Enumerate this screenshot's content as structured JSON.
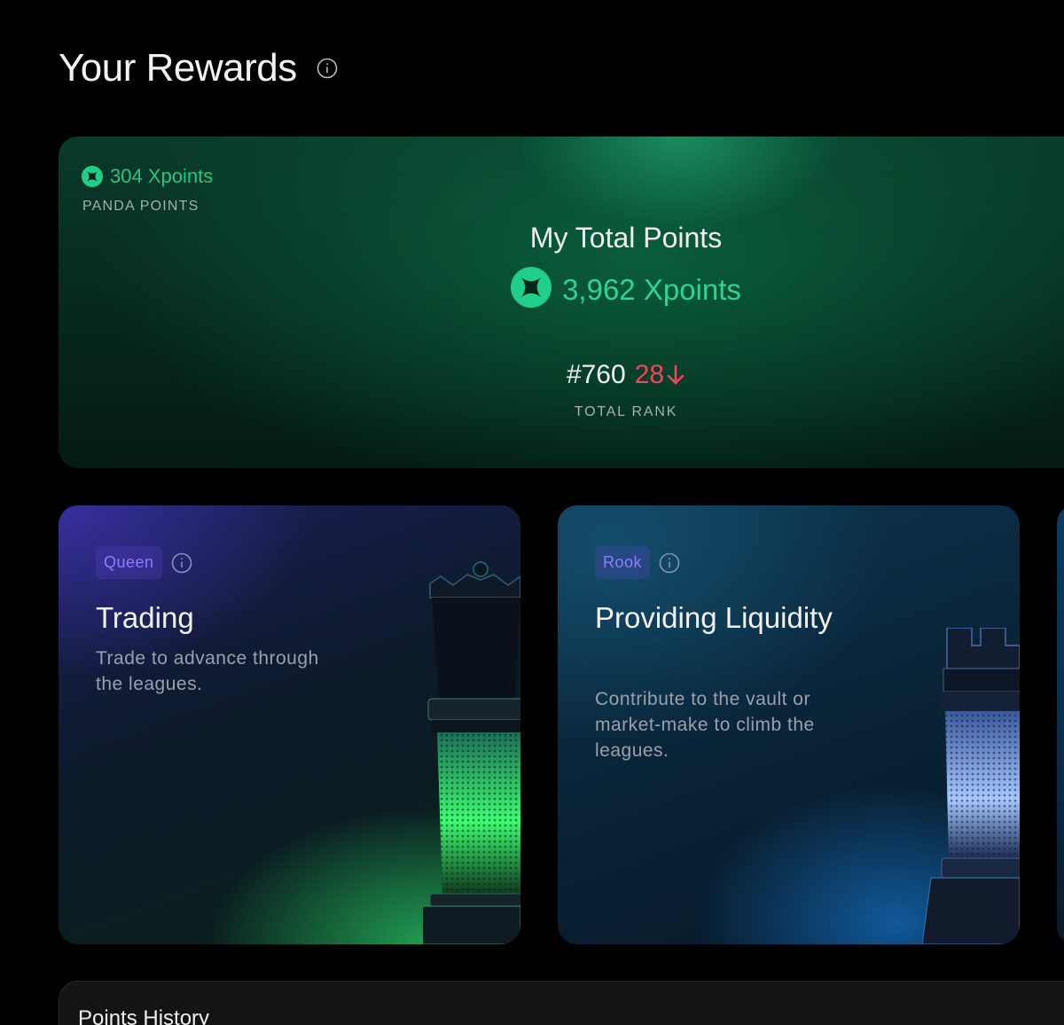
{
  "header": {
    "title": "Your Rewards",
    "info_icon": "info-icon"
  },
  "total_card": {
    "panda_points": {
      "value": "304 Xpoints",
      "label": "PANDA POINTS",
      "icon": "xpoints-icon"
    },
    "total_points_label": "My Total Points",
    "total_points_value": "3,962 Xpoints",
    "rank": {
      "value": "#760",
      "change": "28",
      "change_direction": "down",
      "label": "TOTAL RANK"
    }
  },
  "leagues": [
    {
      "tag": "Queen",
      "title": "Trading",
      "description": "Trade to advance through the leagues.",
      "piece": "queen-chess-piece"
    },
    {
      "tag": "Rook",
      "title": "Providing Liquidity",
      "description": "Contribute to the vault or market-make to climb the leagues.",
      "piece": "rook-chess-piece"
    }
  ],
  "history": {
    "title": "Points History"
  },
  "colors": {
    "accent_green": "#2fd490",
    "rank_down_red": "#f0455c",
    "tag_purple": "#8f7cff",
    "background": "#000000"
  }
}
